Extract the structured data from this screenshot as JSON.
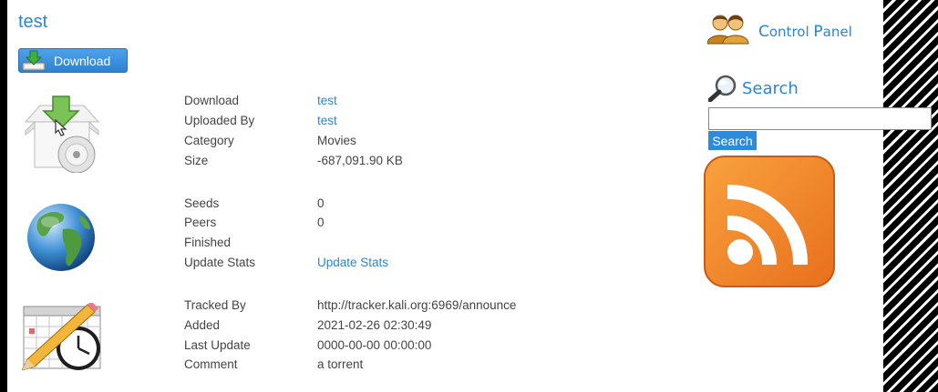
{
  "title": "test",
  "download_button": {
    "label": "Download"
  },
  "details": [
    {
      "label": "Download",
      "value": "test",
      "link": true
    },
    {
      "label": "Uploaded By",
      "value": "test",
      "link": true
    },
    {
      "label": "Category",
      "value": "Movies",
      "link": false
    },
    {
      "label": "Size",
      "value": "-687,091.90 KB",
      "link": false
    }
  ],
  "stats": [
    {
      "label": "Seeds",
      "value": "0",
      "link": false
    },
    {
      "label": "Peers",
      "value": "0",
      "link": false
    },
    {
      "label": "Finished",
      "value": "",
      "link": false
    },
    {
      "label": "Update Stats",
      "value": "Update Stats",
      "link": true
    }
  ],
  "tracking": [
    {
      "label": "Tracked By",
      "value": "http://tracker.kali.org:6969/announce",
      "link": false
    },
    {
      "label": "Added",
      "value": "2021-02-26 02:30:49",
      "link": false
    },
    {
      "label": "Last Update",
      "value": "0000-00-00 00:00:00",
      "link": false
    },
    {
      "label": "Comment",
      "value": "a torrent",
      "link": false
    }
  ],
  "sidebar": {
    "control_panel": {
      "first_c": "C",
      "ontrol": "ontrol ",
      "first_p": "P",
      "anel": "anel"
    },
    "search": {
      "heading": "Search",
      "input_value": "",
      "button_label": "Search"
    }
  },
  "colors": {
    "link": "#2a86d6",
    "button": "#2e8bdc",
    "rss_orange": "#f08a2a"
  },
  "icons": [
    "download-arrow-icon",
    "download-box-icon",
    "globe-icon",
    "calendar-clock-icon",
    "users-icon",
    "magnifier-icon",
    "rss-icon"
  ]
}
